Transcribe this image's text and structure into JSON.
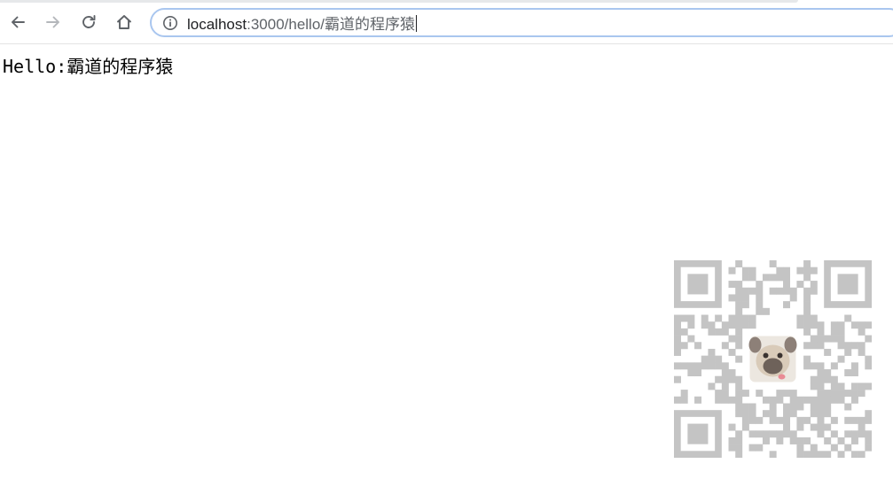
{
  "browser": {
    "url_host": "localhost",
    "url_path": ":3000/hello/霸道的程序猿"
  },
  "page": {
    "greeting": "Hello:霸道的程序猿"
  },
  "qr_code": {
    "module_color": "#c4c4c4",
    "center_image": "pug-dog-avatar"
  }
}
